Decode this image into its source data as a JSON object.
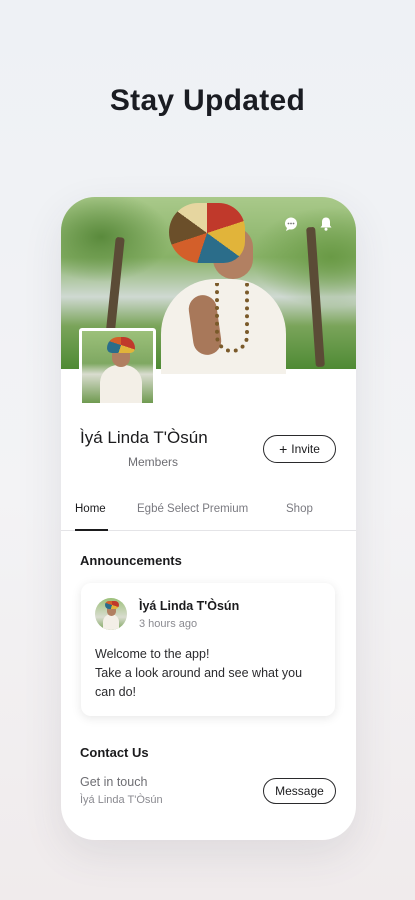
{
  "headline": "Stay Updated",
  "profile": {
    "name": "Ìyá Linda T'Òsún",
    "role": "Members",
    "invite_label": "Invite"
  },
  "tabs": [
    {
      "label": "Home",
      "active": true
    },
    {
      "label": "Egbé Select Premium",
      "active": false
    },
    {
      "label": "Shop",
      "active": false
    }
  ],
  "announcements": {
    "title": "Announcements",
    "post": {
      "author": "Ìyá Linda T'Òsún",
      "time": "3 hours ago",
      "lines": [
        "Welcome to the app!",
        "Take a look around and see what you",
        "can do!"
      ]
    }
  },
  "contact": {
    "title": "Contact Us",
    "subtitle": "Get in touch",
    "name": "Ìyá Linda T'Òsún",
    "message_label": "Message"
  },
  "icons": {
    "chat": "chat-bubble-icon",
    "notifications": "bell-icon"
  }
}
